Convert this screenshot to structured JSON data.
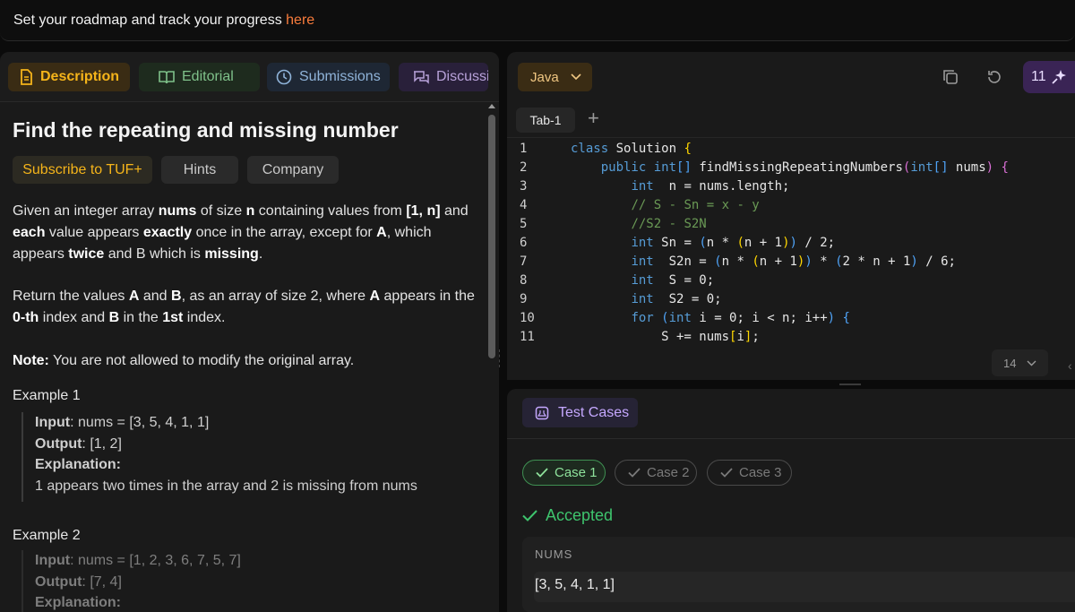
{
  "topbar": {
    "text": "Set your roadmap and track your progress ",
    "link": "here"
  },
  "left_tabs": {
    "description": "Description",
    "editorial": "Editorial",
    "submissions": "Submissions",
    "discussion": "Discussi"
  },
  "problem": {
    "title": "Find the repeating and missing number",
    "chips": {
      "subscribe": "Subscribe to TUF+",
      "hints": "Hints",
      "company": "Company"
    },
    "statement": {
      "t1": "Given an integer array ",
      "b1": "nums",
      "t2": " of size ",
      "b2": "n",
      "t3": " containing values from ",
      "b3": "[1, n]",
      "t4": " and ",
      "b4": "each",
      "t5": " value appears ",
      "b5": "exactly",
      "t6": " once in the array, except for ",
      "b6": "A",
      "t7": ", which appears ",
      "b7": "twice",
      "t8": " and B which is ",
      "b8": "missing",
      "t9": "."
    },
    "return_para": {
      "t1": "Return the values ",
      "b1": "A",
      "t2": " and ",
      "b2": "B",
      "t3": ", as an array of size 2, where ",
      "b3": "A",
      "t4": " appears in the ",
      "b4": "0-th",
      "t5": " index and ",
      "b5": "B",
      "t6": " in the ",
      "b6": "1st",
      "t7": " index."
    },
    "note": {
      "label": "Note:",
      "text": " You are not allowed to modify the original array."
    },
    "example1": {
      "title": "Example 1",
      "input_label": "Input",
      "input": ": nums = [3, 5, 4, 1, 1]",
      "output_label": "Output",
      "output": ": [1, 2]",
      "explanation_label": "Explanation:",
      "explanation": "1 appears two times in the array and 2 is missing from nums"
    },
    "example2": {
      "title": "Example 2",
      "input_label": "Input",
      "input": ": nums = [1, 2, 3, 6, 7, 5, 7]",
      "output_label": "Output",
      "output": ": [7, 4]",
      "explanation_label": "Explanation:"
    }
  },
  "editor": {
    "language": "Java",
    "ai_count": "11",
    "tab": "Tab-1",
    "font_size": "14",
    "lines": [
      {
        "n": "1"
      },
      {
        "n": "2"
      },
      {
        "n": "3"
      },
      {
        "n": "4"
      },
      {
        "n": "5"
      },
      {
        "n": "6"
      },
      {
        "n": "7"
      },
      {
        "n": "8"
      },
      {
        "n": "9"
      },
      {
        "n": "10"
      },
      {
        "n": "11"
      }
    ]
  },
  "tests": {
    "tab": "Test Cases",
    "cases": [
      "Case 1",
      "Case 2",
      "Case 3"
    ],
    "status": "Accepted",
    "nums_label": "NUMS",
    "nums_value": "[3, 5, 4, 1, 1]"
  },
  "colors": {
    "accent_orange": "#f97c3c",
    "active_tab": "#f5b41a",
    "accepted_green": "#3ec46d",
    "test_purple": "#c5a8ff"
  },
  "icons": [
    "document-icon",
    "book-icon",
    "clock-icon",
    "chat-icon",
    "chevron-down-icon",
    "copy-icon",
    "reset-icon",
    "sparkle-icon",
    "plus-icon",
    "flask-icon",
    "check-icon"
  ]
}
